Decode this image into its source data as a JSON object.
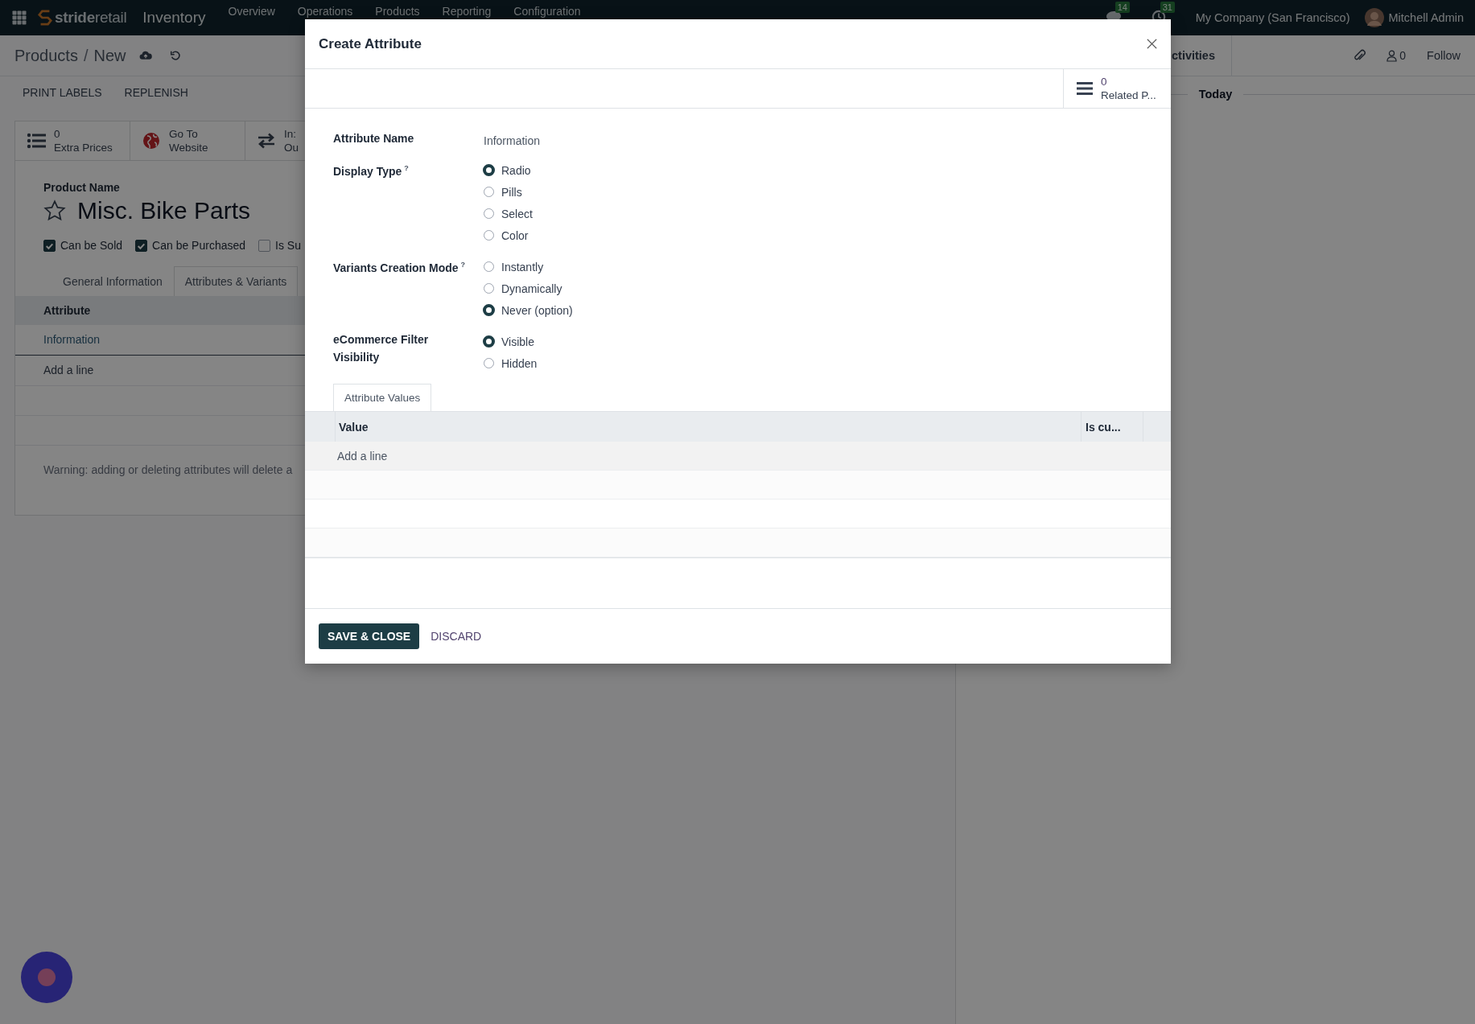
{
  "topbar": {
    "logo": "**stride**retail",
    "module": "Inventory",
    "menu": [
      "Overview",
      "Operations",
      "Products",
      "Reporting",
      "Configuration"
    ],
    "messages_count": "14",
    "activities_count": "31",
    "company": "My Company (San Francisco)",
    "user": "Mitchell Admin"
  },
  "control_panel": {
    "parent": "Products",
    "separator": "/",
    "current": "New",
    "actions": [
      "PRINT LABELS",
      "REPLENISH"
    ]
  },
  "form": {
    "smart_buttons": [
      {
        "kind": "list",
        "lines": [
          "0",
          "Extra Prices"
        ]
      },
      {
        "kind": "globe",
        "lines": [
          "Go To",
          "Website"
        ]
      },
      {
        "kind": "arrows",
        "lines": [
          "In:",
          "Ou"
        ]
      }
    ],
    "name_label": "Product Name",
    "starred": false,
    "name": "Misc. Bike Parts",
    "checkboxes": [
      {
        "label": "Can be Sold",
        "checked": true
      },
      {
        "label": "Can be Purchased",
        "checked": true
      },
      {
        "label": "Is Su",
        "checked": false
      }
    ],
    "tabs": [
      {
        "label": "General Information",
        "selected": false
      },
      {
        "label": "Attributes & Variants",
        "selected": true
      }
    ],
    "table": {
      "column": "Attribute",
      "rows": [
        "Information"
      ],
      "add_line": "Add a line"
    },
    "warning": "Warning: adding or deleting attributes will delete a"
  },
  "chatter": {
    "activities": "ctivities",
    "followers_count": "0",
    "follow": "Follow",
    "date_separator": "Today"
  },
  "dialog": {
    "title": "Create Attribute",
    "button_box": {
      "count": "0",
      "label": "Related P..."
    },
    "fields": [
      {
        "kind": "text",
        "label": "Attribute Name",
        "value": "Information"
      },
      {
        "kind": "radio",
        "label": "Display Type",
        "help": "?",
        "options": [
          {
            "label": "Radio",
            "selected": true
          },
          {
            "label": "Pills",
            "selected": false
          },
          {
            "label": "Select",
            "selected": false
          },
          {
            "label": "Color",
            "selected": false
          }
        ]
      },
      {
        "kind": "radio",
        "label": "Variants Creation Mode",
        "help": "?",
        "options": [
          {
            "label": "Instantly",
            "selected": false
          },
          {
            "label": "Dynamically",
            "selected": false
          },
          {
            "label": "Never (option)",
            "selected": true
          }
        ]
      },
      {
        "kind": "radio",
        "label": "eCommerce Filter Visibility",
        "options": [
          {
            "label": "Visible",
            "selected": true
          },
          {
            "label": "Hidden",
            "selected": false
          }
        ]
      }
    ],
    "tab": {
      "label": "Attribute Values",
      "selected": true
    },
    "table": {
      "columns": [
        "Value",
        "Is cu..."
      ],
      "add_line": "Add a line"
    },
    "buttons": [
      {
        "kind": "primary",
        "label": "SAVE & CLOSE"
      },
      {
        "kind": "secondary",
        "label": "DISCARD"
      }
    ]
  }
}
